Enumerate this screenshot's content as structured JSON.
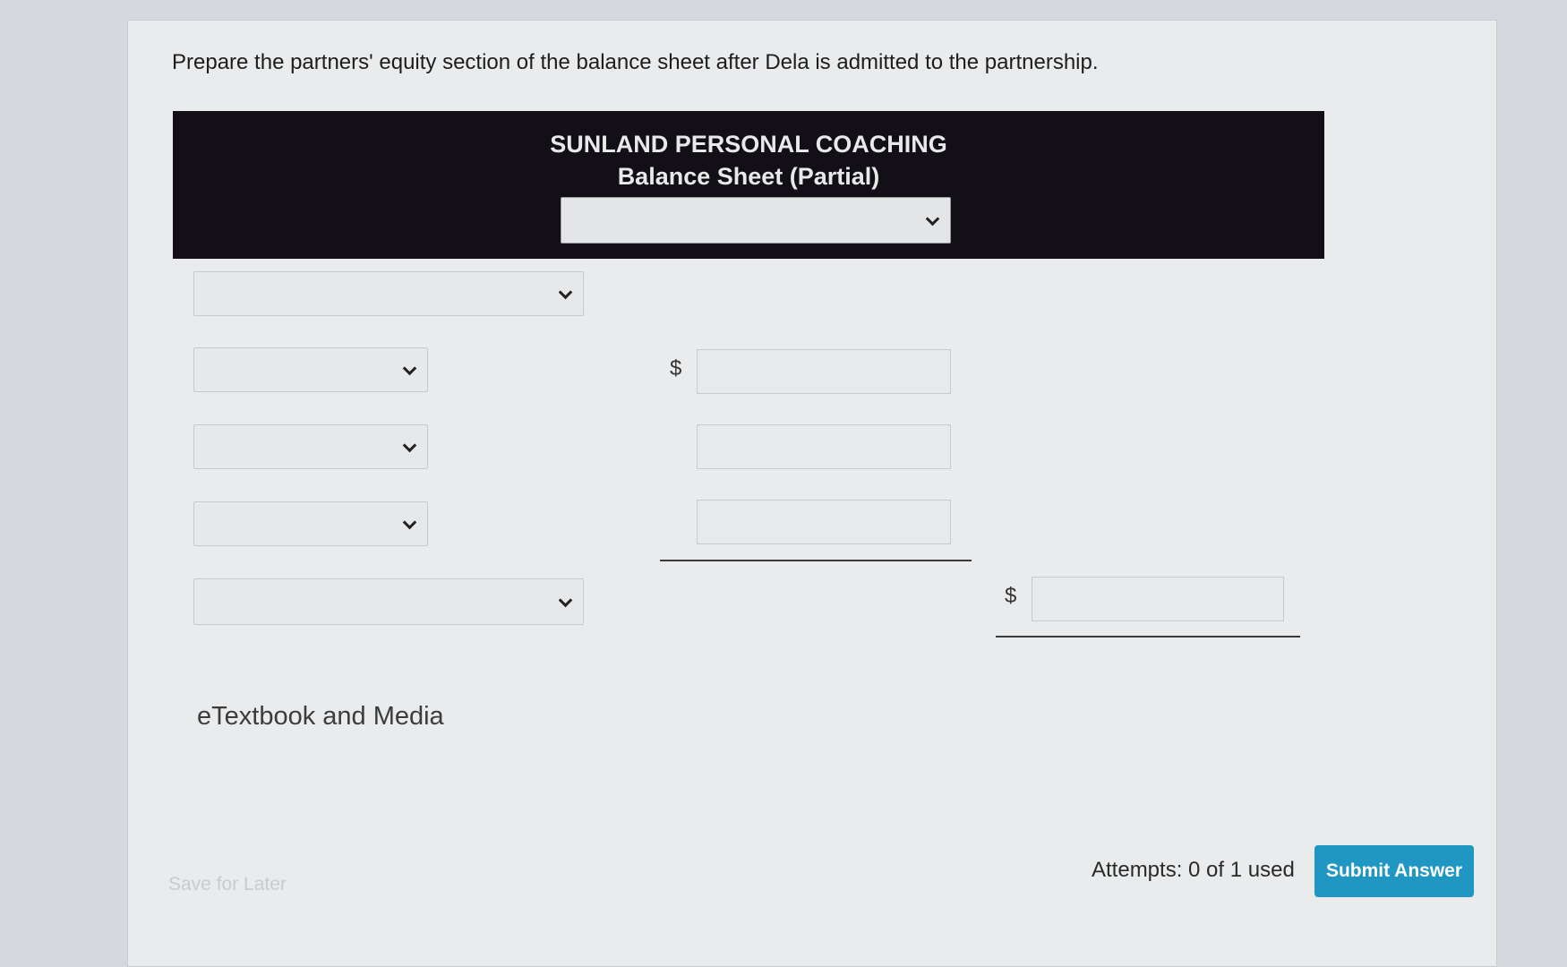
{
  "prompt": "Prepare the partners' equity section of the balance sheet after Dela is admitted to the partnership.",
  "statement_header": {
    "company": "SUNLAND PERSONAL COACHING",
    "title": "Balance Sheet (Partial)",
    "date_select": ""
  },
  "rows": {
    "section_select": "",
    "partner_1_select": "",
    "partner_1_currency": "$",
    "partner_1_amount": "",
    "partner_2_select": "",
    "partner_2_amount": "",
    "partner_3_select": "",
    "partner_3_amount": "",
    "total_select": "",
    "total_currency": "$",
    "total_amount": ""
  },
  "links": {
    "etextbook": "eTextbook and Media"
  },
  "footer": {
    "save_label": "Save for Later",
    "attempts": "Attempts: 0 of 1 used",
    "submit_label": "Submit Answer"
  },
  "colors": {
    "header_bg": "#121016",
    "submit_bg": "#1f97c2"
  }
}
